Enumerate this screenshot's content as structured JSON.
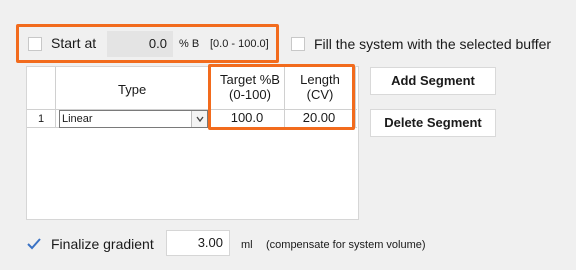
{
  "start_at": {
    "label": "Start at",
    "value": "0.0",
    "unit": "% B",
    "range": "[0.0 - 100.0]",
    "checked": false
  },
  "fill_system": {
    "label": "Fill the system with the selected buffer",
    "checked": false
  },
  "table": {
    "columns": {
      "type": "Type",
      "target_line1": "Target %B",
      "target_line2": "(0-100)",
      "length_line1": "Length",
      "length_line2": "(CV)"
    },
    "rows": [
      {
        "index": "1",
        "type": "Linear",
        "target": "100.0",
        "length": "20.00"
      }
    ]
  },
  "buttons": {
    "add_segment": "Add Segment",
    "delete_segment": "Delete Segment"
  },
  "finalize": {
    "label": "Finalize gradient",
    "checked": true,
    "value": "3.00",
    "unit": "ml",
    "note": "(compensate for system volume)"
  },
  "colors": {
    "highlight": "#f26b1d",
    "check": "#3a72c4"
  }
}
